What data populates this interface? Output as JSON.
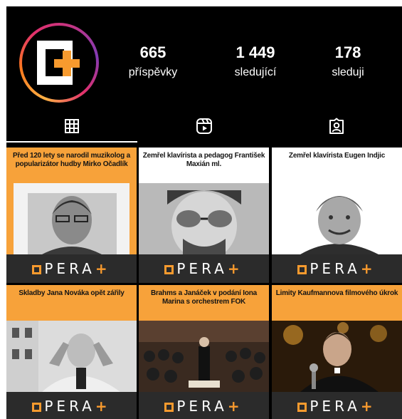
{
  "profile": {
    "stats": [
      {
        "value": "665",
        "label": "příspěvky"
      },
      {
        "value": "1 449",
        "label": "sledující"
      },
      {
        "value": "178",
        "label": "sleduji"
      }
    ]
  },
  "tabs": [
    {
      "icon": "grid-icon",
      "active": true
    },
    {
      "icon": "reels-icon",
      "active": false
    },
    {
      "icon": "tagged-icon",
      "active": false
    }
  ],
  "posts": [
    {
      "caption": "Před 120 lety se narodil muzikolog a popularizátor hudby Mirko Očadlík",
      "brand": "OPERA+"
    },
    {
      "caption": "Zemřel klavírista a pedagog František Maxián ml.",
      "brand": "OPERA+"
    },
    {
      "caption": "Zemřel klavírista Eugen Indjic",
      "brand": "OPERA+"
    },
    {
      "caption": "Skladby Jana Nováka opět zářily",
      "brand": "OPERA+"
    },
    {
      "caption": "Brahms a Janáček v podání Iona Marina s orchestrem FOK",
      "brand": "OPERA+"
    },
    {
      "caption": "Limity Kaufmannova filmového úkrok",
      "brand": "OPERA+"
    }
  ],
  "colors": {
    "accent": "#f79a2e",
    "background": "#000000"
  }
}
